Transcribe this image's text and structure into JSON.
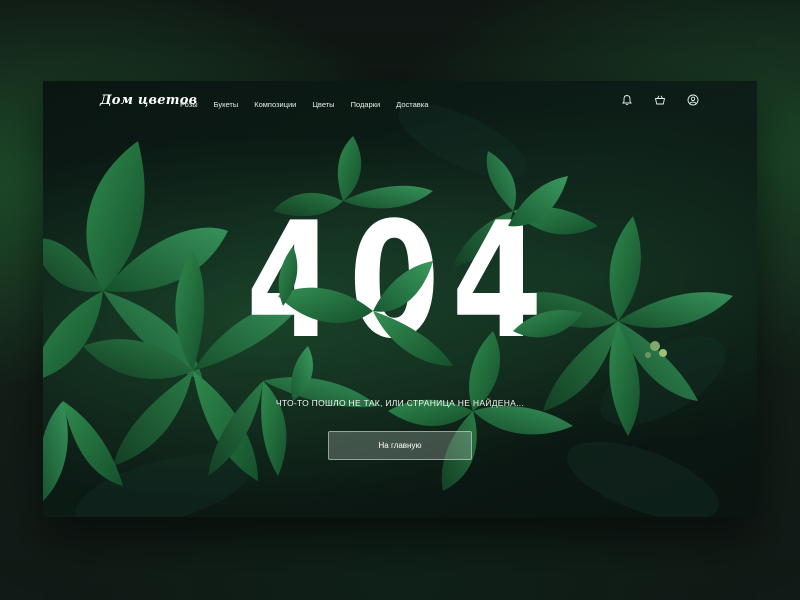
{
  "nav": {
    "logo": "Дом цветов",
    "items": [
      {
        "label": "Розы"
      },
      {
        "label": "Букеты"
      },
      {
        "label": "Композиции"
      },
      {
        "label": "Цветы"
      },
      {
        "label": "Подарки"
      },
      {
        "label": "Доставка"
      }
    ],
    "icons": [
      "bell-icon",
      "basket-icon",
      "user-icon"
    ]
  },
  "error": {
    "code": "404",
    "message": "ЧТО-ТО ПОШЛО НЕ ТАК, ИЛИ СТРАНИЦА НЕ НАЙДЕНА...",
    "home_button": "На главную"
  },
  "colors": {
    "background": "#0d1d17",
    "leaf": "#1f6b3a",
    "leaf_light": "#2e8a4c",
    "text": "#ffffff"
  }
}
